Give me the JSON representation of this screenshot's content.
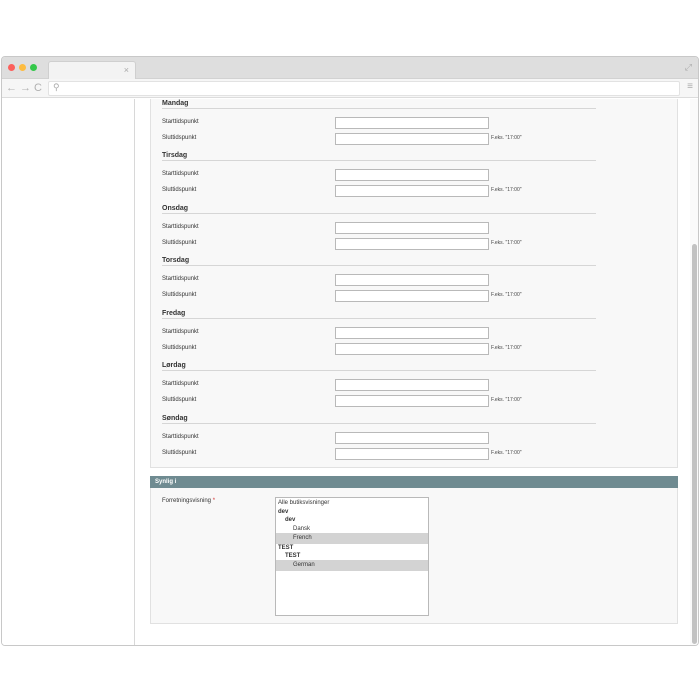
{
  "browser": {
    "tab_close": "×",
    "expand": "⤢",
    "nav_back": "←",
    "nav_forward": "→",
    "nav_reload": "C",
    "url_search": "⚲",
    "menu": "≡"
  },
  "hours": {
    "days": [
      {
        "name": "Mandag",
        "start_label": "Starttidspunkt",
        "end_label": "Sluttidspunkt",
        "start_value": "",
        "end_value": "",
        "hint": "F.eks. \"17:00\""
      },
      {
        "name": "Tirsdag",
        "start_label": "Starttidspunkt",
        "end_label": "Sluttidspunkt",
        "start_value": "",
        "end_value": "",
        "hint": "F.eks. \"17:00\""
      },
      {
        "name": "Onsdag",
        "start_label": "Starttidspunkt",
        "end_label": "Sluttidspunkt",
        "start_value": "",
        "end_value": "",
        "hint": "F.eks. \"17:00\""
      },
      {
        "name": "Torsdag",
        "start_label": "Starttidspunkt",
        "end_label": "Sluttidspunkt",
        "start_value": "",
        "end_value": "",
        "hint": "F.eks. \"17:00\""
      },
      {
        "name": "Fredag",
        "start_label": "Starttidspunkt",
        "end_label": "Sluttidspunkt",
        "start_value": "",
        "end_value": "",
        "hint": "F.eks. \"17:00\""
      },
      {
        "name": "Lørdag",
        "start_label": "Starttidspunkt",
        "end_label": "Sluttidspunkt",
        "start_value": "",
        "end_value": "",
        "hint": "F.eks. \"17:00\""
      },
      {
        "name": "Søndag",
        "start_label": "Starttidspunkt",
        "end_label": "Sluttidspunkt",
        "start_value": "",
        "end_value": "",
        "hint": "F.eks. \"17:00\""
      }
    ]
  },
  "synlig": {
    "title": "Synlig i",
    "field_label": "Forretningsvisning",
    "required_mark": "*",
    "options": [
      {
        "label": "Alle butiksvisninger",
        "selected": false
      },
      {
        "label": "dev",
        "selected": false
      },
      {
        "label": "dev",
        "selected": false
      },
      {
        "label": "Dansk",
        "selected": false
      },
      {
        "label": "French",
        "selected": true
      },
      {
        "label": "TEST",
        "selected": false
      },
      {
        "label": "TEST",
        "selected": false
      },
      {
        "label": "German",
        "selected": true
      }
    ]
  }
}
